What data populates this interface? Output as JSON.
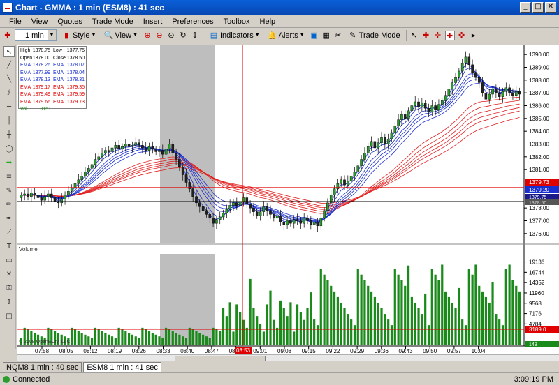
{
  "window": {
    "title": "Chart - GMMA : 1 min (ESM8) : 41 sec",
    "minimize": "_",
    "maximize": "□",
    "close": "✕"
  },
  "menu": [
    "File",
    "View",
    "Quotes",
    "Trade Mode",
    "Insert",
    "Preferences",
    "Toolbox",
    "Help"
  ],
  "toolbar": {
    "interval_value": "1 min",
    "style_label": "Style",
    "view_label": "View",
    "indicators_label": "Indicators",
    "alerts_label": "Alerts",
    "trade_mode_label": "Trade Mode"
  },
  "info": {
    "high_label": "High",
    "high": "1378.75",
    "low_label": "Low",
    "low": "1377.75",
    "open_label": "Open",
    "open": "1378.00",
    "close_label": "Close",
    "close": "1378.50",
    "ema_label": "EMA",
    "ema_left": [
      "1378.26",
      "1377.99",
      "1378.13",
      "1379.17",
      "1379.49",
      "1379.66"
    ],
    "ema_right": [
      "1378.07",
      "1378.04",
      "1378.31",
      "1379.35",
      "1379.59",
      "1379.73"
    ],
    "vol_label": "Vol",
    "vol": "3151"
  },
  "chart_data": {
    "type": "candlestick",
    "price_ticks": [
      "1390.00",
      "1389.00",
      "1388.00",
      "1387.00",
      "1386.00",
      "1385.00",
      "1384.00",
      "1383.00",
      "1382.00",
      "1381.00",
      "1378.00",
      "1377.00",
      "1376.00"
    ],
    "price_ylim": [
      1375.5,
      1390.5
    ],
    "price_labels": {
      "red": "1379.73",
      "blue": "1379.20",
      "navy": "1379.75",
      "black": "1378.50"
    },
    "red_line_value": 1379.6,
    "black_line_value": 1378.5,
    "volume_label": "Volume",
    "volume_ticks": [
      "19136",
      "16744",
      "14352",
      "11960",
      "9568",
      "7176",
      "4784"
    ],
    "volume_ylim": [
      0,
      21000
    ],
    "volume_labels": {
      "red": "3189.0",
      "green": "149"
    },
    "x_ticks": [
      "07:58",
      "08:05",
      "08:12",
      "08:19",
      "08:26",
      "08:33",
      "08:40",
      "08:47",
      "08:54",
      "09:01",
      "09:08",
      "09:15",
      "09:22",
      "09:29",
      "09:36",
      "09:43",
      "09:50",
      "09:57",
      "10:04"
    ],
    "cursor_time": "08:53",
    "copyright": "© 2008 OpenECry, LLC",
    "close": [
      1379.0,
      1379.1,
      1378.9,
      1379.2,
      1379.0,
      1378.8,
      1378.6,
      1378.9,
      1379.1,
      1378.8,
      1378.5,
      1378.4,
      1378.7,
      1379.0,
      1379.3,
      1379.6,
      1379.9,
      1380.2,
      1380.5,
      1380.8,
      1381.1,
      1381.4,
      1381.8,
      1382.0,
      1382.3,
      1382.5,
      1382.4,
      1382.7,
      1382.9,
      1382.6,
      1382.8,
      1383.0,
      1382.8,
      1382.9,
      1383.1,
      1382.9,
      1382.7,
      1382.5,
      1382.8,
      1382.6,
      1382.4,
      1382.5,
      1382.2,
      1382.6,
      1383.0,
      1382.3,
      1381.8,
      1381.2,
      1380.6,
      1380.0,
      1379.5,
      1378.9,
      1378.4,
      1378.1,
      1377.8,
      1377.5,
      1377.2,
      1376.8,
      1377.1,
      1377.3,
      1377.6,
      1377.9,
      1378.2,
      1378.4,
      1378.2,
      1378.5,
      1378.8,
      1378.3,
      1378.0,
      1377.7,
      1377.4,
      1377.7,
      1378.1,
      1377.8,
      1377.5,
      1377.2,
      1377.4,
      1376.9,
      1376.7,
      1377.0,
      1376.8,
      1377.1,
      1377.0,
      1376.8,
      1377.2,
      1377.0,
      1376.7,
      1376.9,
      1376.6,
      1377.2,
      1377.8,
      1378.4,
      1379.0,
      1379.5,
      1379.9,
      1380.2,
      1379.8,
      1380.1,
      1380.5,
      1380.8,
      1381.3,
      1381.8,
      1382.3,
      1382.8,
      1383.2,
      1382.7,
      1383.1,
      1383.5,
      1383.0,
      1383.4,
      1383.9,
      1384.4,
      1384.9,
      1385.3,
      1385.0,
      1385.6,
      1386.0,
      1386.3,
      1385.9,
      1386.2,
      1385.8,
      1385.5,
      1386.0,
      1385.7,
      1386.1,
      1386.4,
      1386.8,
      1387.3,
      1387.8,
      1388.2,
      1388.7,
      1389.3,
      1389.8,
      1389.2,
      1388.6,
      1388.2,
      1387.8,
      1387.0,
      1386.5,
      1386.9,
      1387.3,
      1387.0,
      1386.7,
      1387.1,
      1387.4,
      1387.0,
      1386.8,
      1387.1,
      1386.9
    ]
  },
  "tabs": [
    "NQM8 1 min : 40 sec",
    "ESM8 1 min : 41 sec"
  ],
  "status": {
    "text": "Connected",
    "clock": "3:09:19 PM"
  }
}
